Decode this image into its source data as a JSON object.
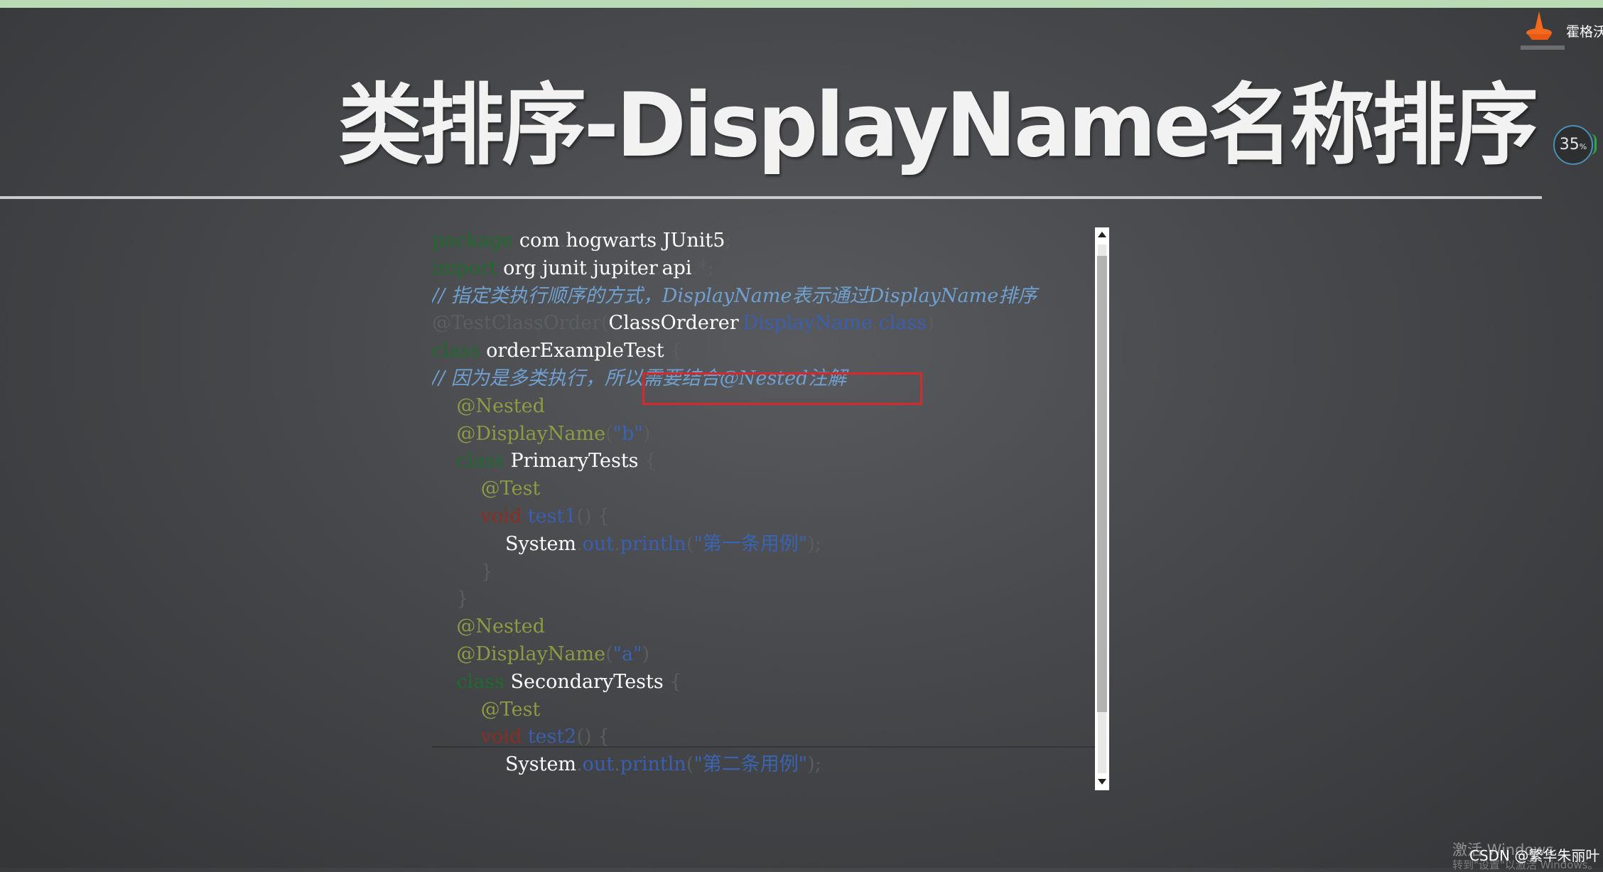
{
  "slide": {
    "title": "类排序-DisplayName名称排序",
    "brand": "霍格沃",
    "progress": "35",
    "progress_unit": "%"
  },
  "code": {
    "lines": [
      [
        {
          "t": "package",
          "c": "kw"
        },
        {
          "t": " com",
          "c": "plain"
        },
        {
          "t": ".",
          "c": "punc"
        },
        {
          "t": "hogwarts",
          "c": "plain"
        },
        {
          "t": ".",
          "c": "punc"
        },
        {
          "t": "JUnit5",
          "c": "plain"
        },
        {
          "t": ";",
          "c": "punc"
        }
      ],
      [
        {
          "t": "import",
          "c": "kw"
        },
        {
          "t": " org",
          "c": "plain"
        },
        {
          "t": ".",
          "c": "punc"
        },
        {
          "t": "junit",
          "c": "plain"
        },
        {
          "t": ".",
          "c": "punc"
        },
        {
          "t": "jupiter",
          "c": "plain"
        },
        {
          "t": ".",
          "c": "punc"
        },
        {
          "t": "api",
          "c": "plain"
        },
        {
          "t": ".*;",
          "c": "punc"
        }
      ],
      [
        {
          "t": "// 指定类执行顺序的方式，DisplayName表示通过DisplayName排序",
          "c": "cmt"
        }
      ],
      [
        {
          "t": "@TestClassOrder",
          "c": "ann2"
        },
        {
          "t": "(",
          "c": "punc"
        },
        {
          "t": "ClassOrderer",
          "c": "plain"
        },
        {
          "t": ".",
          "c": "punc"
        },
        {
          "t": "DisplayName",
          "c": "field"
        },
        {
          "t": ".",
          "c": "punc"
        },
        {
          "t": "class",
          "c": "field"
        },
        {
          "t": ")",
          "c": "punc"
        }
      ],
      [
        {
          "t": "class",
          "c": "kw"
        },
        {
          "t": " orderExampleTest ",
          "c": "plain"
        },
        {
          "t": "{",
          "c": "punc"
        }
      ],
      [
        {
          "t": "// 因为是多类执行，",
          "c": "cmt"
        },
        {
          "t": "所以需要结合@Nested注解",
          "c": "cmt"
        }
      ],
      [
        {
          "t": "    ",
          "c": "plain"
        },
        {
          "t": "@Nested",
          "c": "ann"
        }
      ],
      [
        {
          "t": "    ",
          "c": "plain"
        },
        {
          "t": "@DisplayName",
          "c": "ann"
        },
        {
          "t": "(",
          "c": "punc"
        },
        {
          "t": "\"b\"",
          "c": "str"
        },
        {
          "t": ")",
          "c": "punc"
        }
      ],
      [
        {
          "t": "    ",
          "c": "plain"
        },
        {
          "t": "class",
          "c": "kw"
        },
        {
          "t": " PrimaryTests ",
          "c": "plain"
        },
        {
          "t": "{",
          "c": "punc"
        }
      ],
      [
        {
          "t": "        ",
          "c": "plain"
        },
        {
          "t": "@Test",
          "c": "ann"
        }
      ],
      [
        {
          "t": "        ",
          "c": "plain"
        },
        {
          "t": "void",
          "c": "void"
        },
        {
          "t": " test1",
          "c": "field"
        },
        {
          "t": "() {",
          "c": "punc"
        }
      ],
      [
        {
          "t": "            System",
          "c": "plain"
        },
        {
          "t": ".",
          "c": "punc"
        },
        {
          "t": "out",
          "c": "field"
        },
        {
          "t": ".",
          "c": "punc"
        },
        {
          "t": "println",
          "c": "field"
        },
        {
          "t": "(",
          "c": "punc"
        },
        {
          "t": "\"第一条用例\"",
          "c": "str"
        },
        {
          "t": ");",
          "c": "punc"
        }
      ],
      [
        {
          "t": "        ",
          "c": "plain"
        },
        {
          "t": "}",
          "c": "punc"
        }
      ],
      [
        {
          "t": "    ",
          "c": "plain"
        },
        {
          "t": "}",
          "c": "punc"
        }
      ],
      [
        {
          "t": "    ",
          "c": "plain"
        },
        {
          "t": "@Nested",
          "c": "ann"
        }
      ],
      [
        {
          "t": "    ",
          "c": "plain"
        },
        {
          "t": "@DisplayName",
          "c": "ann"
        },
        {
          "t": "(",
          "c": "punc"
        },
        {
          "t": "\"a\"",
          "c": "str"
        },
        {
          "t": ")",
          "c": "punc"
        }
      ],
      [
        {
          "t": "    ",
          "c": "plain"
        },
        {
          "t": "class",
          "c": "kw"
        },
        {
          "t": " SecondaryTests ",
          "c": "plain"
        },
        {
          "t": "{",
          "c": "punc"
        }
      ],
      [
        {
          "t": "        ",
          "c": "plain"
        },
        {
          "t": "@Test",
          "c": "ann"
        }
      ],
      [
        {
          "t": "        ",
          "c": "plain"
        },
        {
          "t": "void",
          "c": "void"
        },
        {
          "t": " test2",
          "c": "field"
        },
        {
          "t": "() {",
          "c": "punc"
        }
      ],
      [
        {
          "t": "            System",
          "c": "plain"
        },
        {
          "t": ".",
          "c": "punc"
        },
        {
          "t": "out",
          "c": "field"
        },
        {
          "t": ".",
          "c": "punc"
        },
        {
          "t": "println",
          "c": "field"
        },
        {
          "t": "(",
          "c": "punc"
        },
        {
          "t": "\"第二条用例\"",
          "c": "str"
        },
        {
          "t": ");",
          "c": "punc"
        }
      ]
    ]
  },
  "overlay": {
    "activate_windows": "激活 Windows",
    "activate_hint": "转到\"设置\"以激活 Windows。",
    "csdn": "CSDN @繁华朱丽叶"
  },
  "colors": {
    "keyword": "#1f6a2d",
    "annotation": "#8f9a44",
    "comment": "#6fa0cf",
    "string": "#3a64b2",
    "highlight_box": "#d7282b"
  }
}
